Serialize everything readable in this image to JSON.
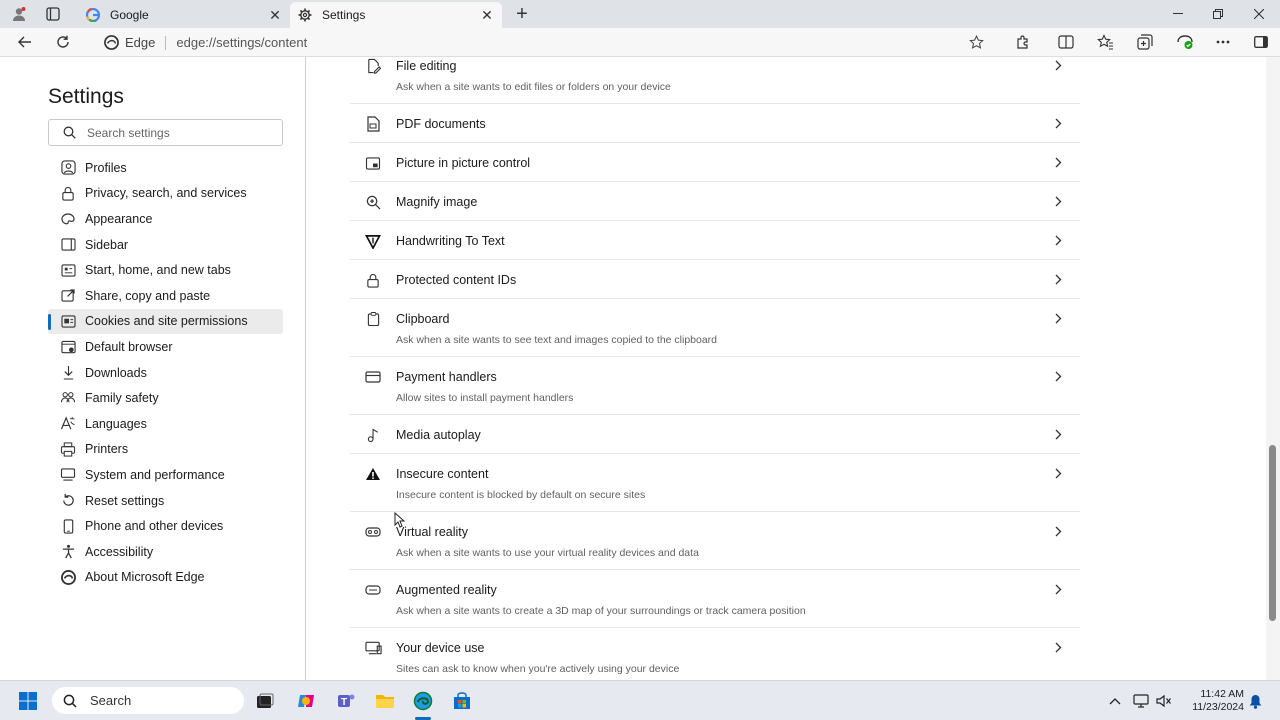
{
  "browser": {
    "tabs": [
      {
        "title": "Google",
        "favicon": "google-icon"
      },
      {
        "title": "Settings",
        "favicon": "gear-icon"
      }
    ],
    "address": {
      "prefix": "Edge",
      "url": "edge://settings/content"
    }
  },
  "sidebar": {
    "title": "Settings",
    "search_placeholder": "Search settings",
    "items": [
      {
        "label": "Profiles",
        "icon": "profile-icon"
      },
      {
        "label": "Privacy, search, and services",
        "icon": "lock-icon"
      },
      {
        "label": "Appearance",
        "icon": "appearance-icon"
      },
      {
        "label": "Sidebar",
        "icon": "sidebar-icon"
      },
      {
        "label": "Start, home, and new tabs",
        "icon": "home-icon"
      },
      {
        "label": "Share, copy and paste",
        "icon": "share-icon"
      },
      {
        "label": "Cookies and site permissions",
        "icon": "cookies-icon",
        "selected": true
      },
      {
        "label": "Default browser",
        "icon": "browser-icon"
      },
      {
        "label": "Downloads",
        "icon": "download-icon"
      },
      {
        "label": "Family safety",
        "icon": "family-icon"
      },
      {
        "label": "Languages",
        "icon": "language-icon"
      },
      {
        "label": "Printers",
        "icon": "printer-icon"
      },
      {
        "label": "System and performance",
        "icon": "system-icon"
      },
      {
        "label": "Reset settings",
        "icon": "reset-icon"
      },
      {
        "label": "Phone and other devices",
        "icon": "phone-icon"
      },
      {
        "label": "Accessibility",
        "icon": "accessibility-icon"
      },
      {
        "label": "About Microsoft Edge",
        "icon": "edge-icon"
      }
    ]
  },
  "permissions": [
    {
      "label": "File editing",
      "desc": "Ask when a site wants to edit files or folders on your device",
      "icon": "file-edit-icon"
    },
    {
      "label": "PDF documents",
      "desc": "",
      "icon": "pdf-icon"
    },
    {
      "label": "Picture in picture control",
      "desc": "",
      "icon": "pip-icon"
    },
    {
      "label": "Magnify image",
      "desc": "",
      "icon": "magnify-icon"
    },
    {
      "label": "Handwriting To Text",
      "desc": "",
      "icon": "handwriting-icon"
    },
    {
      "label": "Protected content IDs",
      "desc": "",
      "icon": "lock-icon"
    },
    {
      "label": "Clipboard",
      "desc": "Ask when a site wants to see text and images copied to the clipboard",
      "icon": "clipboard-icon"
    },
    {
      "label": "Payment handlers",
      "desc": "Allow sites to install payment handlers",
      "icon": "payment-icon"
    },
    {
      "label": "Media autoplay",
      "desc": "",
      "icon": "media-icon"
    },
    {
      "label": "Insecure content",
      "desc": "Insecure content is blocked by default on secure sites",
      "icon": "warning-icon"
    },
    {
      "label": "Virtual reality",
      "desc": "Ask when a site wants to use your virtual reality devices and data",
      "icon": "vr-icon"
    },
    {
      "label": "Augmented reality",
      "desc": "Ask when a site wants to create a 3D map of your surroundings or track camera position",
      "icon": "ar-icon"
    },
    {
      "label": "Your device use",
      "desc": "Sites can ask to know when you're actively using your device",
      "icon": "device-icon"
    }
  ],
  "taskbar": {
    "search_label": "Search",
    "time": "11:42 AM",
    "date": "11/23/2024"
  },
  "colors": {
    "accent": "#0f6cbd"
  }
}
